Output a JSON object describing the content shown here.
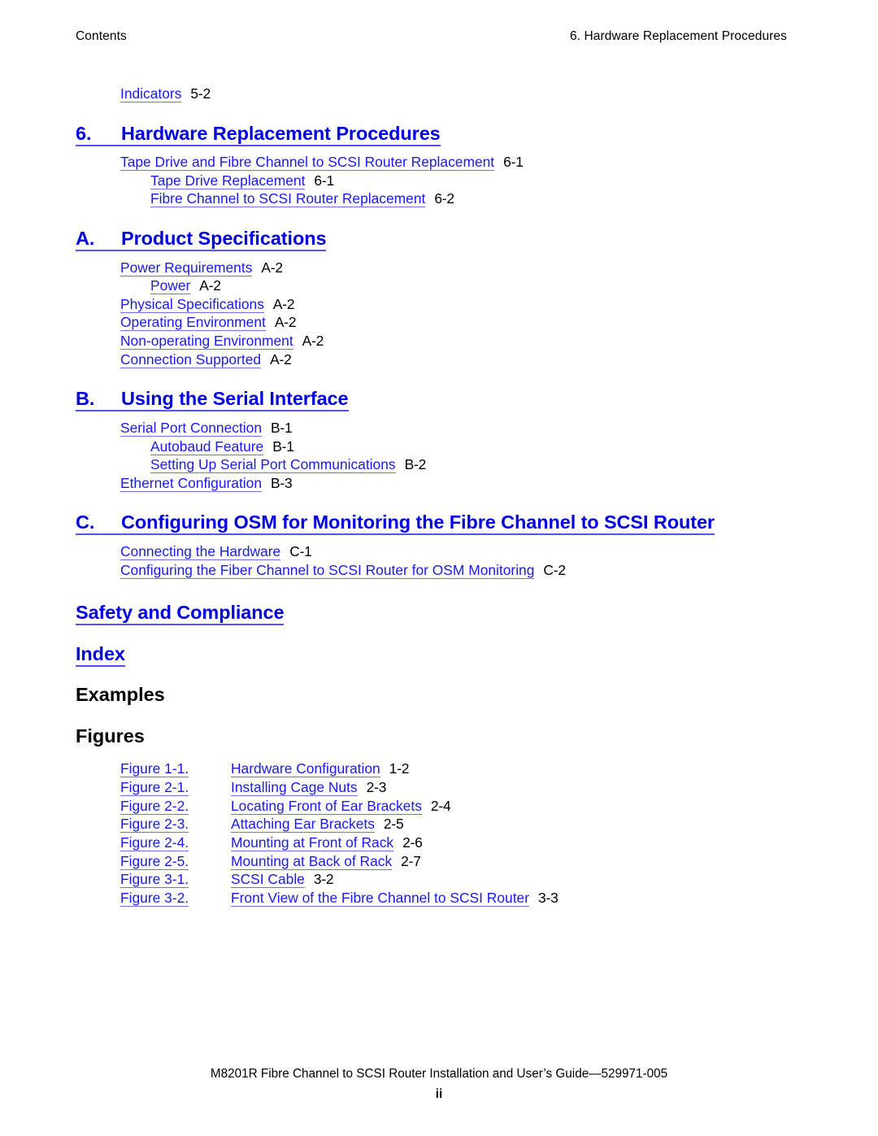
{
  "header": {
    "left": "Contents",
    "right": "6.  Hardware Replacement Procedures"
  },
  "colors": {
    "link": "#1a1aee",
    "heading_link": "#0000e0",
    "text": "#000000",
    "page_background": "#ffffff"
  },
  "toc": {
    "orphan_entry": {
      "title": "Indicators",
      "page": "5-2"
    },
    "chapter6": {
      "number": "6.",
      "title": "Hardware Replacement Procedures",
      "entries": [
        {
          "title": "Tape Drive and Fibre Channel to SCSI Router Replacement",
          "page": "6-1",
          "level": 1
        },
        {
          "title": "Tape Drive Replacement",
          "page": "6-1",
          "level": 2
        },
        {
          "title": "Fibre Channel to SCSI Router Replacement",
          "page": "6-2",
          "level": 2
        }
      ]
    },
    "appendixA": {
      "number": "A.",
      "title": "Product Specifications",
      "entries": [
        {
          "title": "Power Requirements",
          "page": "A-2",
          "level": 1
        },
        {
          "title": "Power",
          "page": "A-2",
          "level": 2
        },
        {
          "title": "Physical Specifications",
          "page": "A-2",
          "level": 1
        },
        {
          "title": "Operating Environment",
          "page": "A-2",
          "level": 1
        },
        {
          "title": "Non-operating Environment",
          "page": "A-2",
          "level": 1
        },
        {
          "title": "Connection Supported",
          "page": "A-2",
          "level": 1
        }
      ]
    },
    "appendixB": {
      "number": "B.",
      "title": "Using the Serial Interface",
      "entries": [
        {
          "title": "Serial Port Connection",
          "page": "B-1",
          "level": 1
        },
        {
          "title": "Autobaud Feature",
          "page": "B-1",
          "level": 2
        },
        {
          "title": "Setting Up Serial Port Communications",
          "page": "B-2",
          "level": 2
        },
        {
          "title": "Ethernet Configuration",
          "page": "B-3",
          "level": 1
        }
      ]
    },
    "appendixC": {
      "number": "C.",
      "title": "Configuring OSM for Monitoring the Fibre Channel to SCSI Router",
      "entries": [
        {
          "title": "Connecting the Hardware",
          "page": "C-1",
          "level": 1
        },
        {
          "title": "Configuring the Fiber Channel to SCSI Router for OSM Monitoring",
          "page": "C-2",
          "level": 1
        }
      ]
    },
    "safety_and_compliance": "Safety and Compliance",
    "index": "Index"
  },
  "examples": {
    "heading": "Examples",
    "entries": []
  },
  "figures": {
    "heading": "Figures",
    "entries": [
      {
        "label": "Figure 1-1.",
        "title": "Hardware Configuration",
        "page": "1-2"
      },
      {
        "label": "Figure 2-1.",
        "title": "Installing Cage Nuts",
        "page": "2-3"
      },
      {
        "label": "Figure 2-2.",
        "title": "Locating Front of Ear Brackets",
        "page": "2-4"
      },
      {
        "label": "Figure 2-3.",
        "title": "Attaching Ear Brackets",
        "page": "2-5"
      },
      {
        "label": "Figure 2-4.",
        "title": "Mounting at Front of Rack",
        "page": "2-6"
      },
      {
        "label": "Figure 2-5.",
        "title": "Mounting at Back of Rack",
        "page": "2-7"
      },
      {
        "label": "Figure 3-1.",
        "title": "SCSI Cable",
        "page": "3-2"
      },
      {
        "label": "Figure 3-2.",
        "title": "Front View of the Fibre Channel to SCSI Router",
        "page": "3-3"
      }
    ]
  },
  "footer": {
    "line": "M8201R Fibre Channel to SCSI Router Installation and User’s Guide—529971-005",
    "folio": "ii"
  }
}
